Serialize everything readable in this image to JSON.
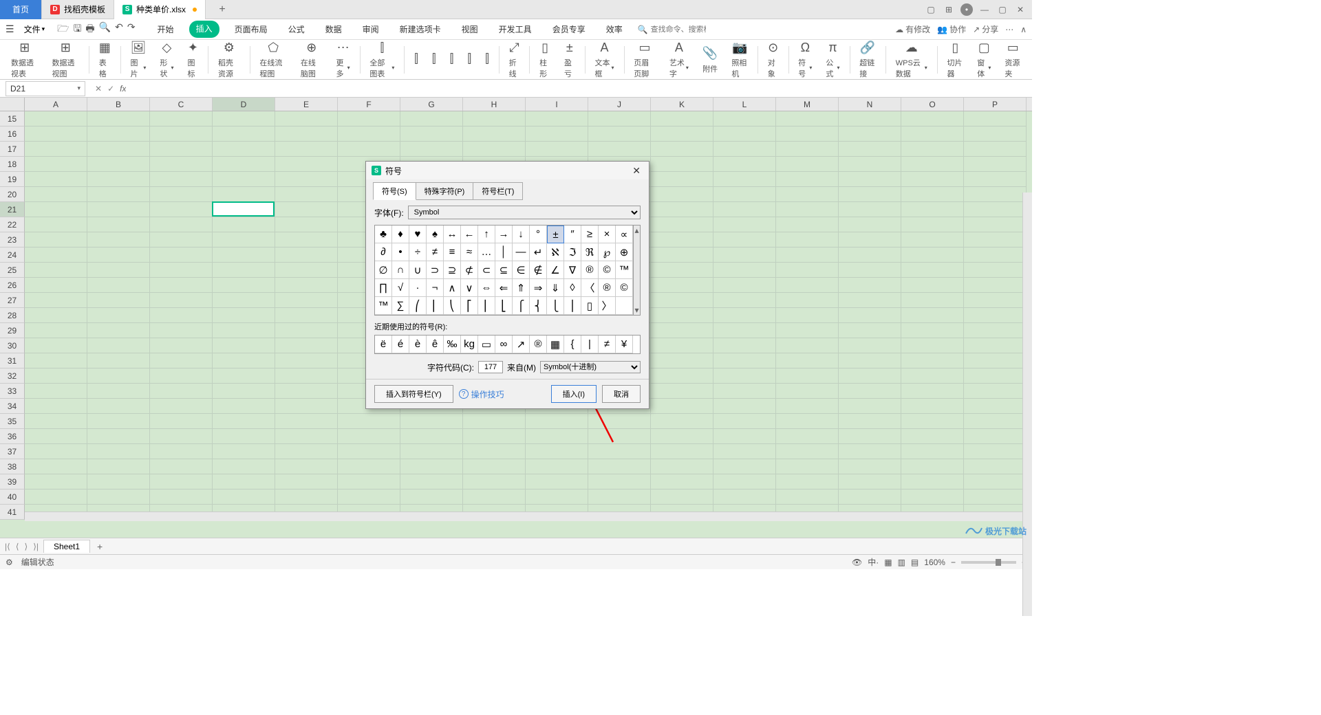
{
  "titleTabs": {
    "home": "首页",
    "template": "找稻壳模板",
    "doc": "种类单价.xlsx"
  },
  "menu": {
    "file": "文件",
    "ribbonTabs": [
      "开始",
      "插入",
      "页面布局",
      "公式",
      "数据",
      "审阅",
      "新建选项卡",
      "视图",
      "开发工具",
      "会员专享",
      "效率"
    ],
    "searchPlaceholder": "查找命令、搜索模板",
    "searchIconLabel": "Q",
    "hasEdits": "有修改",
    "coop": "协作",
    "share": "分享"
  },
  "ribbon": {
    "items": [
      {
        "icon": "⊞",
        "label": "数据透视表"
      },
      {
        "icon": "⊞",
        "label": "数据透视图"
      },
      {
        "icon": "▦",
        "label": "表格"
      },
      {
        "icon": "🖼",
        "label": "图片",
        "dd": true
      },
      {
        "icon": "◇",
        "label": "形状",
        "dd": true
      },
      {
        "icon": "✦",
        "label": "图标"
      },
      {
        "icon": "⚙",
        "label": "稻壳资源"
      },
      {
        "icon": "⬠",
        "label": "在线流程图"
      },
      {
        "icon": "⊕",
        "label": "在线脑图"
      },
      {
        "icon": "⋯",
        "label": "更多",
        "dd": true
      },
      {
        "icon": "⫿",
        "label": "全部图表",
        "dd": true
      },
      {
        "icon": "⫿",
        "label": ""
      },
      {
        "icon": "⫿",
        "label": ""
      },
      {
        "icon": "⫿",
        "label": ""
      },
      {
        "icon": "⫿",
        "label": ""
      },
      {
        "icon": "⫿",
        "label": ""
      },
      {
        "icon": "⤢",
        "label": "折线"
      },
      {
        "icon": "▯",
        "label": "柱形"
      },
      {
        "icon": "±",
        "label": "盈亏"
      },
      {
        "icon": "A",
        "label": "文本框",
        "dd": true
      },
      {
        "icon": "▭",
        "label": "页眉页脚"
      },
      {
        "icon": "A",
        "label": "艺术字",
        "dd": true
      },
      {
        "icon": "📎",
        "label": "附件"
      },
      {
        "icon": "📷",
        "label": "照相机"
      },
      {
        "icon": "⊙",
        "label": "对象"
      },
      {
        "icon": "Ω",
        "label": "符号",
        "dd": true
      },
      {
        "icon": "π",
        "label": "公式",
        "dd": true
      },
      {
        "icon": "🔗",
        "label": "超链接"
      },
      {
        "icon": "☁",
        "label": "WPS云数据",
        "dd": true
      },
      {
        "icon": "▯",
        "label": "切片器"
      },
      {
        "icon": "▢",
        "label": "窗体",
        "dd": true
      },
      {
        "icon": "▭",
        "label": "资源夹"
      }
    ]
  },
  "nameBox": "D21",
  "columns": [
    "A",
    "B",
    "C",
    "D",
    "E",
    "F",
    "G",
    "H",
    "I",
    "J",
    "K",
    "L",
    "M",
    "N",
    "O",
    "P"
  ],
  "rowStart": 15,
  "rowEnd": 41,
  "activeCol": 3,
  "activeRow": 21,
  "sheet": {
    "name": "Sheet1"
  },
  "status": {
    "mode": "编辑状态",
    "zoom": "160%"
  },
  "dialog": {
    "title": "符号",
    "tabs": [
      "符号(S)",
      "特殊字符(P)",
      "符号栏(T)"
    ],
    "fontLabel": "字体(F):",
    "fontValue": "Symbol",
    "symbols": [
      "♣",
      "♦",
      "♥",
      "♠",
      "↔",
      "←",
      "↑",
      "→",
      "↓",
      "°",
      "±",
      "″",
      "≥",
      "×",
      "∝",
      "∂",
      "•",
      "÷",
      "≠",
      "≡",
      "≈",
      "…",
      "│",
      "—",
      "↵",
      "ℵ",
      "ℑ",
      "ℜ",
      "℘",
      "⊕",
      "∅",
      "∩",
      "∪",
      "⊃",
      "⊇",
      "⊄",
      "⊂",
      "⊆",
      "∈",
      "∉",
      "∠",
      "∇",
      "®",
      "©",
      "™",
      "∏",
      "√",
      "·",
      "¬",
      "∧",
      "∨",
      "⇔",
      "⇐",
      "⇑",
      "⇒",
      "⇓",
      "◊",
      "〈",
      "®",
      "©",
      "™",
      "∑",
      "⎛",
      "⎜",
      "⎝",
      "⎡",
      "⎢",
      "⎣",
      "⎧",
      "⎨",
      "⎩",
      "⎪",
      "▯",
      "〉"
    ],
    "selectedSymbolIndex": 10,
    "recentLabel": "近期使用过的符号(R):",
    "recent": [
      "ë",
      "é",
      "è",
      "ê",
      "‰",
      "kg",
      "▭",
      "∞",
      "↗",
      "®",
      "▦",
      "{",
      "|",
      "≠",
      "¥"
    ],
    "charCodeLabel": "字符代码(C):",
    "charCode": "177",
    "fromLabel": "来自(M)",
    "fromValue": "Symbol(十进制)",
    "insertToBar": "插入到符号栏(Y)",
    "tips": "操作技巧",
    "insert": "插入(I)",
    "cancel": "取消"
  },
  "watermark": "极光下载站"
}
